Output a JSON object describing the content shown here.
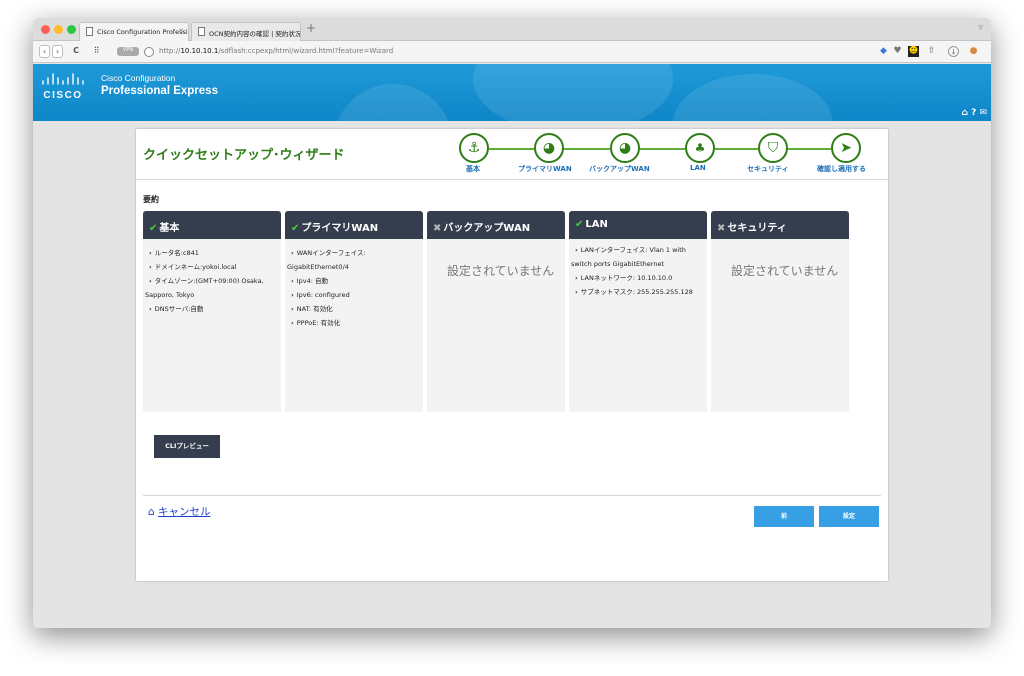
{
  "browser": {
    "tabs": [
      {
        "label": "Cisco Configuration Professi",
        "active": true
      },
      {
        "label": "OCN契約内容の確認 | 契約状況",
        "active": false
      }
    ],
    "url_prefix": "http://",
    "url_host": "10.10.10.1",
    "url_path": "/sdflash:ccpexp/html/wizard.html?feature=Wizard"
  },
  "banner": {
    "logo_text": "CISCO",
    "product_line1": "Cisco Configuration",
    "product_line2": "Professional Express"
  },
  "wizard": {
    "title": "クイックセットアップ･ウィザード",
    "steps": [
      {
        "label": "基本",
        "icon": "anchor-icon"
      },
      {
        "label": "プライマリWAN",
        "icon": "globe-icon"
      },
      {
        "label": "バックアップWAN",
        "icon": "globe-icon"
      },
      {
        "label": "LAN",
        "icon": "network-icon"
      },
      {
        "label": "セキュリティ",
        "icon": "shield-icon"
      },
      {
        "label": "確認し適用する",
        "icon": "send-icon"
      }
    ]
  },
  "summary": {
    "label": "要約",
    "not_set_text": "設定されていません",
    "panels": {
      "basic": {
        "title": "基本",
        "items": [
          "ルータ名:c841",
          "ドメインネーム:yokoi.local",
          "タイムゾーン:(GMT+09:00) Osaka,",
          "Sapporo, Tokyo",
          "DNSサーバ:自動"
        ]
      },
      "primary_wan": {
        "title": "プライマリWAN",
        "items": [
          "WANインターフェイス:",
          "GigabitEthernet0/4",
          "Ipv4: 自動",
          "Ipv6: configured",
          "NAT: 有効化",
          "PPPoE: 有効化"
        ]
      },
      "backup_wan": {
        "title": "バックアップWAN"
      },
      "lan": {
        "title": "LAN",
        "items": [
          "LANインターフェイス: Vlan 1 with",
          "switch ports GigabitEthernet",
          "LANネットワーク: 10.10.10.0",
          "サブネットマスク: 255.255.255.128"
        ]
      },
      "security": {
        "title": "セキュリティ"
      }
    }
  },
  "actions": {
    "cli_preview": "CLIプレビュー",
    "cancel": "キャンセル",
    "back": "前",
    "apply": "設定"
  },
  "colors": {
    "accent_green": "#2e7d16",
    "panel_header": "#353e4e",
    "banner_blue": "#1f9ad8",
    "button_blue": "#37a0e4",
    "check_green": "#47d13a"
  }
}
